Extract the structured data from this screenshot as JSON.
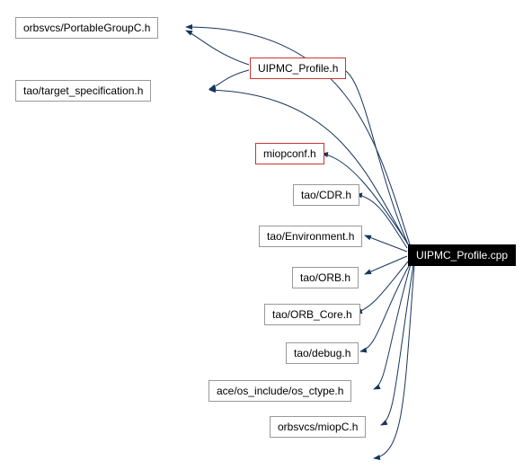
{
  "diagram": {
    "source": "UIPMC_Profile.cpp",
    "nodes": {
      "portable_group": "orbsvcs/PortableGroupC.h",
      "uipmc_profile_h": "UIPMC_Profile.h",
      "target_spec": "tao/target_specification.h",
      "miopconf": "miopconf.h",
      "cdr": "tao/CDR.h",
      "environment": "tao/Environment.h",
      "orb": "tao/ORB.h",
      "orb_core": "tao/ORB_Core.h",
      "debug": "tao/debug.h",
      "os_ctype": "ace/os_include/os_ctype.h",
      "miopc": "orbsvcs/miopC.h"
    }
  }
}
